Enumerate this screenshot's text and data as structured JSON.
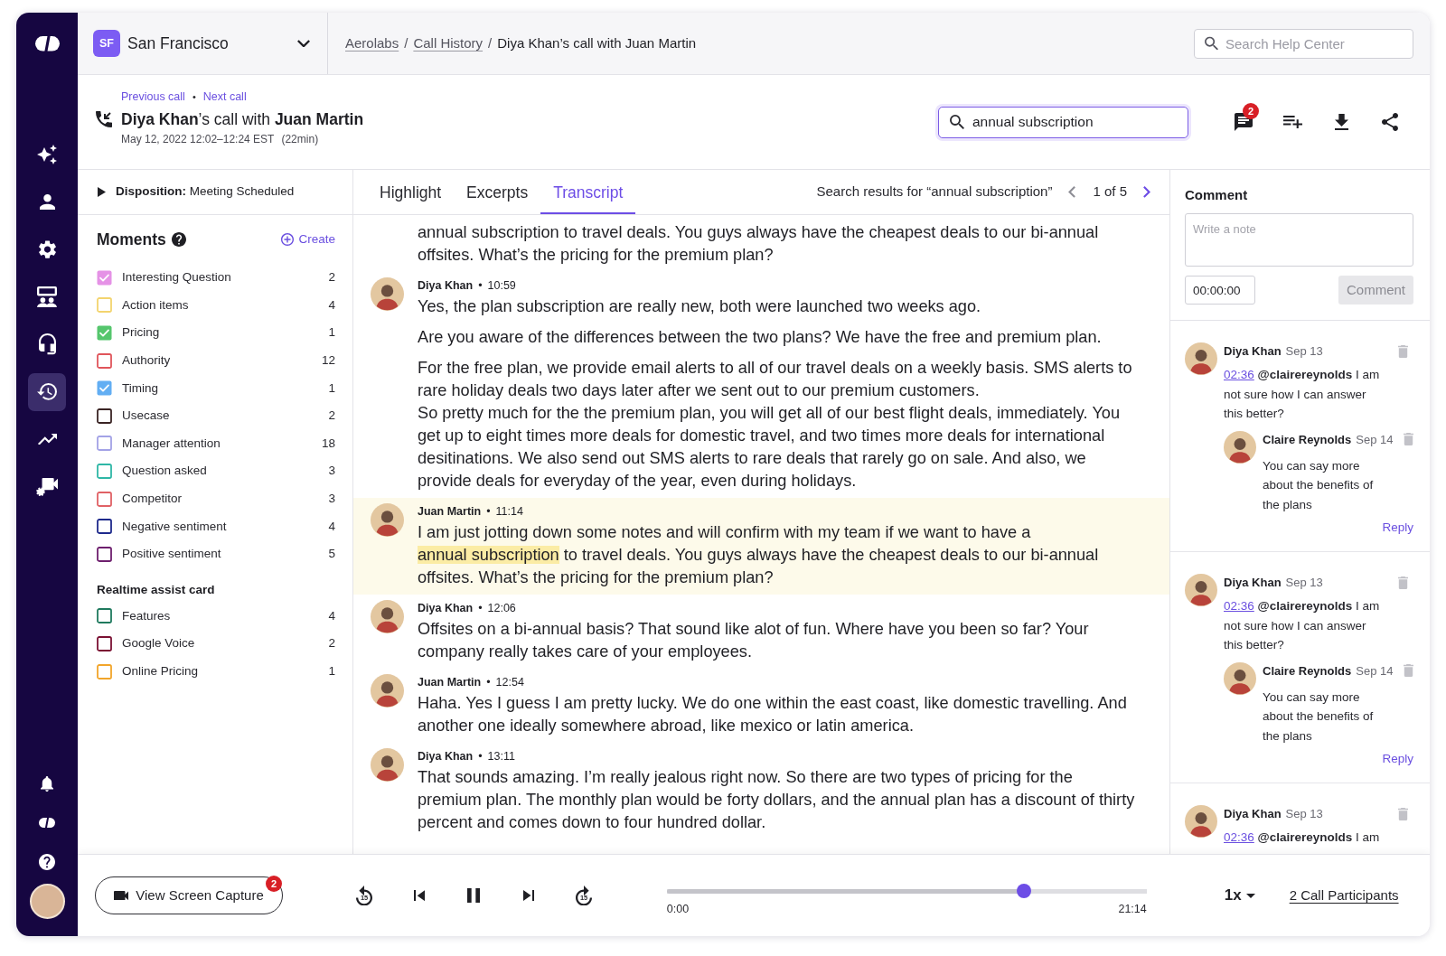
{
  "sidebar": {
    "items": [
      {
        "selected": false
      },
      {
        "selected": false
      },
      {
        "selected": false
      },
      {
        "selected": false
      },
      {
        "selected": false
      },
      {
        "selected": true
      },
      {
        "selected": false
      },
      {
        "selected": false
      }
    ]
  },
  "location_selector": {
    "badge": "SF",
    "name": "San Francisco"
  },
  "breadcrumb": [
    {
      "kind": "link",
      "label": "Aerolabs"
    },
    {
      "kind": "separator",
      "label": "/"
    },
    {
      "kind": "link",
      "label": "Call History"
    },
    {
      "kind": "separator",
      "label": "/"
    },
    {
      "kind": "current",
      "label": "Diya Khan’s call with Juan Martin"
    }
  ],
  "help_search": {
    "placeholder": "Search Help Center"
  },
  "call": {
    "previous_link": "Previous call",
    "separator": "•",
    "next_link": "Next call",
    "title": "**Diya Khan**’s call with **Juan Martin**",
    "date": "May 12, 2022 12:02–12:24 EST",
    "duration": "(22min)"
  },
  "transcript_search": {
    "value": "annual subscription"
  },
  "toolbar": {
    "comments_badge": "2"
  },
  "disposition": {
    "expanded": false,
    "text": "**Disposition:** Meeting Scheduled"
  },
  "moments": {
    "title": "Moments",
    "create_link": "Create",
    "items": [
      {
        "label": "Interesting Question",
        "count": "2",
        "color": "#e592e6",
        "checked": true
      },
      {
        "label": "Action items",
        "count": "4",
        "color": "#f3d46e",
        "checked": false
      },
      {
        "label": "Pricing",
        "count": "1",
        "color": "#55c66d",
        "checked": true
      },
      {
        "label": "Authority",
        "count": "12",
        "color": "#e0555b",
        "checked": false
      },
      {
        "label": "Timing",
        "count": "1",
        "color": "#62aef3",
        "checked": true
      },
      {
        "label": "Usecase",
        "count": "2",
        "color": "#3a2424",
        "checked": false
      },
      {
        "label": "Manager attention",
        "count": "18",
        "color": "#a3a2e6",
        "checked": false
      },
      {
        "label": "Question asked",
        "count": "3",
        "color": "#2fb7a6",
        "checked": false
      },
      {
        "label": "Competitor",
        "count": "3",
        "color": "#e06165",
        "checked": false
      },
      {
        "label": "Negative sentiment",
        "count": "4",
        "color": "#1e2a8c",
        "checked": false
      },
      {
        "label": "Positive sentiment",
        "count": "5",
        "color": "#6e1f6e",
        "checked": false
      }
    ]
  },
  "realtime_assist": {
    "title": "Realtime assist card",
    "items": [
      {
        "label": "Features",
        "count": "4",
        "color": "#1f7a5e",
        "checked": false
      },
      {
        "label": "Google Voice",
        "count": "2",
        "color": "#7b1133",
        "checked": false
      },
      {
        "label": "Online Pricing",
        "count": "1",
        "color": "#f2a52a",
        "checked": false
      }
    ]
  },
  "tabs": [
    {
      "label": "Highlight",
      "selected": false
    },
    {
      "label": "Excerpts",
      "selected": false
    },
    {
      "label": "Transcript",
      "selected": true
    }
  ],
  "search_results": {
    "text": "Search results for “annual subscription”",
    "position": "1 of 5",
    "prev_disabled": true,
    "next_disabled": false
  },
  "transcript": [
    {
      "current": false,
      "paragraphs": [
        [
          {
            "text": "annual subscription to travel deals. You guys always have the cheapest deals to our bi-annual offsites. What’s the pricing for the premium plan?",
            "match": false
          }
        ]
      ]
    },
    {
      "speaker": "Diya Khan",
      "bullet": "•",
      "time": "10:59",
      "current": false,
      "paragraphs": [
        [
          {
            "text": "Yes, the plan subscription are really new, both were launched two weeks ago.",
            "match": false
          }
        ],
        [
          {
            "text": "Are you aware of the differences between the two plans? We have the free and premium plan.",
            "match": false
          }
        ],
        [
          {
            "text": "For the free plan, we provide email alerts to all of our travel deals on a weekly basis. SMS alerts to rare holiday deals two days later after we sent out to our premium customers.\nSo pretty much for the the premium plan, you will get all of our best flight deals, immediately. You get up to eight times more deals for domestic travel, and two times more deals for international desitinations. We also send out SMS alerts to rare deals that rarely go on sale. And also, we provide deals for everyday of the year, even during holidays.",
            "match": false
          }
        ]
      ]
    },
    {
      "speaker": "Juan Martin",
      "bullet": "•",
      "time": "11:14",
      "current": true,
      "paragraphs": [
        [
          {
            "text": "I am just jotting down some notes and will confirm with my team if we want to have a ",
            "match": false
          },
          {
            "text": "annual subscription",
            "match": true
          },
          {
            "text": " to travel deals. You guys always have the cheapest deals to our bi-annual offsites. What’s the pricing for the premium plan?",
            "match": false
          }
        ]
      ]
    },
    {
      "speaker": "Diya Khan",
      "bullet": "•",
      "time": "12:06",
      "current": false,
      "paragraphs": [
        [
          {
            "text": "Offsites on a bi-annual basis? That sound like alot of fun. Where have you been so far? Your company really takes care of your employees.",
            "match": false
          }
        ]
      ]
    },
    {
      "speaker": "Juan Martin",
      "bullet": "•",
      "time": "12:54",
      "current": false,
      "paragraphs": [
        [
          {
            "text": "Haha. Yes I guess I am pretty lucky. We do one within the east coast, like domestic travelling. And another one ideally somewhere abroad, like mexico or latin america.",
            "match": false
          }
        ]
      ]
    },
    {
      "speaker": "Diya Khan",
      "bullet": "•",
      "time": "13:11",
      "current": false,
      "paragraphs": [
        [
          {
            "text": "That sounds amazing. I’m really jealous right now. So there are two types of pricing for the premium plan. The monthly plan would be forty dollars, and the annual plan has a discount of thirty percent and comes down to four hundred dollar.",
            "match": false
          }
        ]
      ]
    }
  ],
  "comment_form": {
    "title": "Comment",
    "placeholder": "Write a note",
    "time": "00:00:00",
    "button": "Comment",
    "button_disabled": true
  },
  "comments": [
    {
      "author": "Diya Khan",
      "date": "Sep 13",
      "timestamp": "02:36",
      "text": "**@clairereynolds** I am not sure how I can answer this better?",
      "replies": [
        {
          "author": "Claire Reynolds",
          "date": "Sep 14",
          "text": "You can say more about the benefits of the plans"
        }
      ],
      "reply_link": "Reply"
    },
    {
      "author": "Diya Khan",
      "date": "Sep 13",
      "timestamp": "02:36",
      "text": "**@clairereynolds** I am not sure how I can answer this better?",
      "replies": [
        {
          "author": "Claire Reynolds",
          "date": "Sep 14",
          "text": "You can say more about the benefits of the plans"
        }
      ],
      "reply_link": "Reply"
    },
    {
      "author": "Diya Khan",
      "date": "Sep 13",
      "timestamp": "02:36",
      "text": "**@clairereynolds** I am"
    }
  ],
  "player": {
    "capture_button": "View Screen Capture",
    "capture_badge": "2",
    "rewind_label": "15",
    "forward_label": "15",
    "playing": true,
    "level": 0.745,
    "start_time": "0:00",
    "end_time": "21:14",
    "speed": "1x",
    "participants": "2 Call Participants"
  }
}
